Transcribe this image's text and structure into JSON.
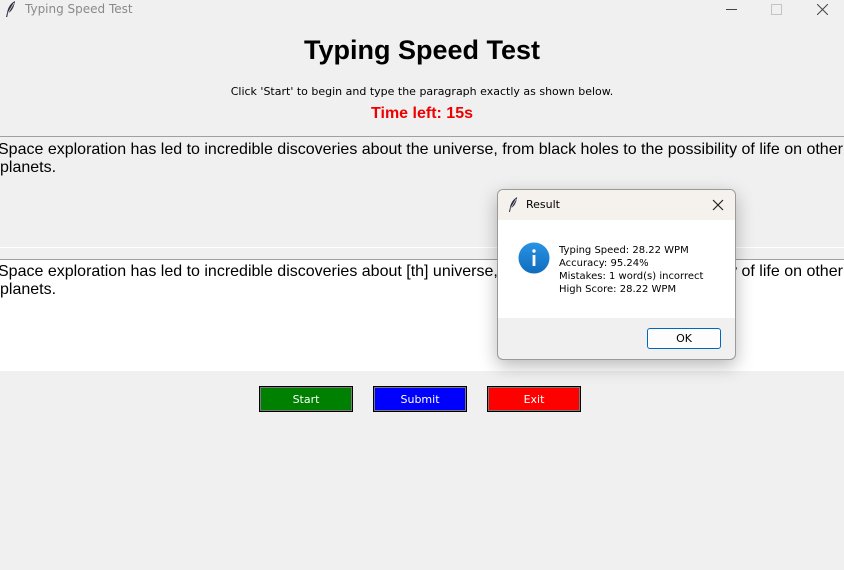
{
  "window": {
    "title": "Typing Speed Test",
    "icon": "feather-icon",
    "controls": [
      "minimize-icon",
      "maximize-icon",
      "close-icon"
    ]
  },
  "header": {
    "title": "Typing Speed Test",
    "instructions": "Click 'Start' to begin and type the paragraph exactly as shown below.",
    "timer": "Time left: 15s"
  },
  "paragraph": {
    "text": "Space exploration has led to incredible discoveries about the universe, from black holes to the possibility of life on other planets."
  },
  "typing": {
    "text": "Space exploration has led to incredible discoveries about [th] universe, from black holes to the possibility of life on other planets."
  },
  "buttons": {
    "start": "Start",
    "submit": "Submit",
    "exit": "Exit"
  },
  "dialog": {
    "title": "Result",
    "icon": "info-icon",
    "lines": {
      "speed": "Typing Speed: 28.22 WPM",
      "accuracy": "Accuracy: 95.24%",
      "mistakes": "Mistakes: 1 word(s) incorrect",
      "high_score": "High Score: 28.22 WPM"
    },
    "ok_label": "OK"
  },
  "colors": {
    "timer": "#ee0000",
    "start": "#008000",
    "submit": "#0000ff",
    "exit": "#ff0000",
    "info_icon": "#1a7fd0"
  }
}
